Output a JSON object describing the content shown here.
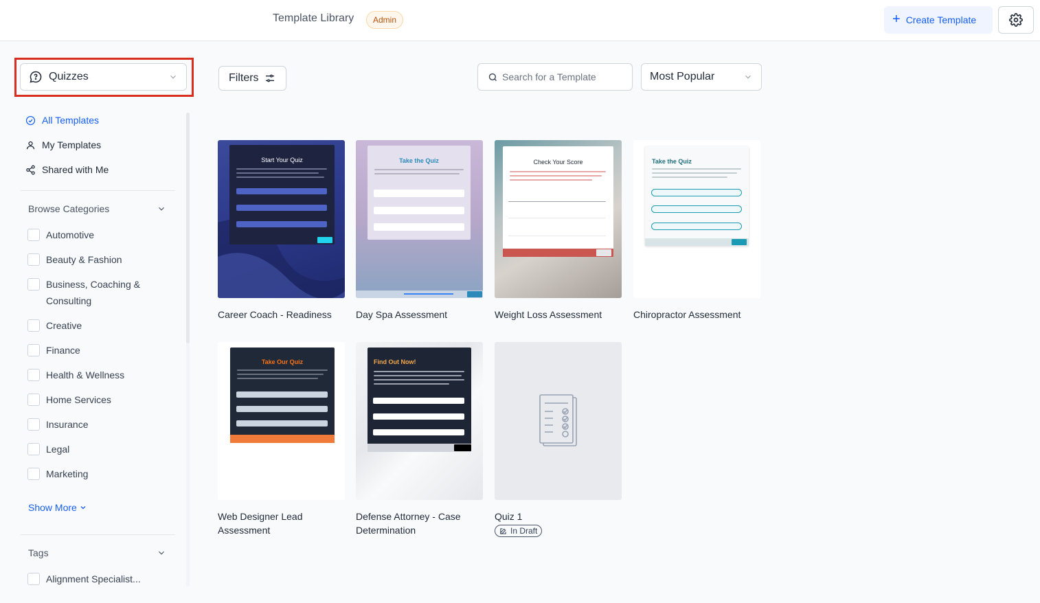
{
  "header": {
    "title": "Template Library",
    "badge": "Admin",
    "create_label": "Create Template"
  },
  "sidebar": {
    "type_select": "Quizzes",
    "nav": [
      {
        "label": "All Templates",
        "icon": "check-circle-icon",
        "active": true
      },
      {
        "label": "My Templates",
        "icon": "user-icon",
        "active": false
      },
      {
        "label": "Shared with Me",
        "icon": "share-icon",
        "active": false
      }
    ],
    "categories_heading": "Browse Categories",
    "categories": [
      {
        "label": "Automotive"
      },
      {
        "label": "Beauty & Fashion"
      },
      {
        "label": "Business, Coaching & Consulting"
      },
      {
        "label": "Creative"
      },
      {
        "label": "Finance"
      },
      {
        "label": "Health & Wellness"
      },
      {
        "label": "Home Services"
      },
      {
        "label": "Insurance"
      },
      {
        "label": "Legal"
      },
      {
        "label": "Marketing"
      }
    ],
    "show_more": "Show More",
    "tags_heading": "Tags",
    "tags": [
      {
        "label": "Alignment Specialist..."
      }
    ]
  },
  "toolbar": {
    "filters_label": "Filters",
    "search_placeholder": "Search for a Template",
    "sort_value": "Most Popular"
  },
  "templates": [
    {
      "title": "Career Coach - Readiness",
      "thumb_heading": "Start Your Quiz"
    },
    {
      "title": "Day Spa Assessment",
      "thumb_heading": "Take the Quiz"
    },
    {
      "title": "Weight Loss Assessment",
      "thumb_heading": "Check Your Score"
    },
    {
      "title": "Chiropractor Assessment",
      "thumb_heading": "Take the Quiz"
    },
    {
      "title": "Web Designer Lead Assessment",
      "thumb_heading": "Take Our Quiz"
    },
    {
      "title": "Defense Attorney - Case Determination",
      "thumb_heading": "Find Out Now!"
    },
    {
      "title": "Quiz 1",
      "status": "In Draft"
    }
  ],
  "colors": {
    "accent": "#155eef",
    "highlight": "#d92d20"
  }
}
